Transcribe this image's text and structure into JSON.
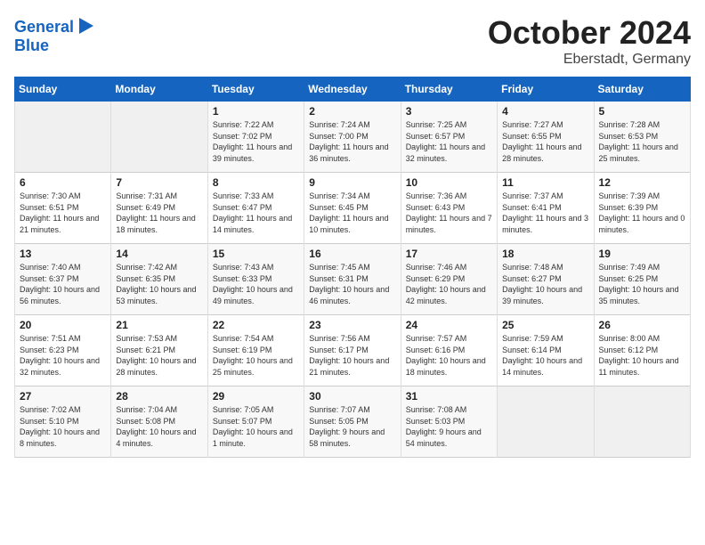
{
  "header": {
    "logo_line1": "General",
    "logo_line2": "Blue",
    "month": "October 2024",
    "location": "Eberstadt, Germany"
  },
  "days_of_week": [
    "Sunday",
    "Monday",
    "Tuesday",
    "Wednesday",
    "Thursday",
    "Friday",
    "Saturday"
  ],
  "weeks": [
    [
      {
        "day": "",
        "info": ""
      },
      {
        "day": "",
        "info": ""
      },
      {
        "day": "1",
        "info": "Sunrise: 7:22 AM\nSunset: 7:02 PM\nDaylight: 11 hours and 39 minutes."
      },
      {
        "day": "2",
        "info": "Sunrise: 7:24 AM\nSunset: 7:00 PM\nDaylight: 11 hours and 36 minutes."
      },
      {
        "day": "3",
        "info": "Sunrise: 7:25 AM\nSunset: 6:57 PM\nDaylight: 11 hours and 32 minutes."
      },
      {
        "day": "4",
        "info": "Sunrise: 7:27 AM\nSunset: 6:55 PM\nDaylight: 11 hours and 28 minutes."
      },
      {
        "day": "5",
        "info": "Sunrise: 7:28 AM\nSunset: 6:53 PM\nDaylight: 11 hours and 25 minutes."
      }
    ],
    [
      {
        "day": "6",
        "info": "Sunrise: 7:30 AM\nSunset: 6:51 PM\nDaylight: 11 hours and 21 minutes."
      },
      {
        "day": "7",
        "info": "Sunrise: 7:31 AM\nSunset: 6:49 PM\nDaylight: 11 hours and 18 minutes."
      },
      {
        "day": "8",
        "info": "Sunrise: 7:33 AM\nSunset: 6:47 PM\nDaylight: 11 hours and 14 minutes."
      },
      {
        "day": "9",
        "info": "Sunrise: 7:34 AM\nSunset: 6:45 PM\nDaylight: 11 hours and 10 minutes."
      },
      {
        "day": "10",
        "info": "Sunrise: 7:36 AM\nSunset: 6:43 PM\nDaylight: 11 hours and 7 minutes."
      },
      {
        "day": "11",
        "info": "Sunrise: 7:37 AM\nSunset: 6:41 PM\nDaylight: 11 hours and 3 minutes."
      },
      {
        "day": "12",
        "info": "Sunrise: 7:39 AM\nSunset: 6:39 PM\nDaylight: 11 hours and 0 minutes."
      }
    ],
    [
      {
        "day": "13",
        "info": "Sunrise: 7:40 AM\nSunset: 6:37 PM\nDaylight: 10 hours and 56 minutes."
      },
      {
        "day": "14",
        "info": "Sunrise: 7:42 AM\nSunset: 6:35 PM\nDaylight: 10 hours and 53 minutes."
      },
      {
        "day": "15",
        "info": "Sunrise: 7:43 AM\nSunset: 6:33 PM\nDaylight: 10 hours and 49 minutes."
      },
      {
        "day": "16",
        "info": "Sunrise: 7:45 AM\nSunset: 6:31 PM\nDaylight: 10 hours and 46 minutes."
      },
      {
        "day": "17",
        "info": "Sunrise: 7:46 AM\nSunset: 6:29 PM\nDaylight: 10 hours and 42 minutes."
      },
      {
        "day": "18",
        "info": "Sunrise: 7:48 AM\nSunset: 6:27 PM\nDaylight: 10 hours and 39 minutes."
      },
      {
        "day": "19",
        "info": "Sunrise: 7:49 AM\nSunset: 6:25 PM\nDaylight: 10 hours and 35 minutes."
      }
    ],
    [
      {
        "day": "20",
        "info": "Sunrise: 7:51 AM\nSunset: 6:23 PM\nDaylight: 10 hours and 32 minutes."
      },
      {
        "day": "21",
        "info": "Sunrise: 7:53 AM\nSunset: 6:21 PM\nDaylight: 10 hours and 28 minutes."
      },
      {
        "day": "22",
        "info": "Sunrise: 7:54 AM\nSunset: 6:19 PM\nDaylight: 10 hours and 25 minutes."
      },
      {
        "day": "23",
        "info": "Sunrise: 7:56 AM\nSunset: 6:17 PM\nDaylight: 10 hours and 21 minutes."
      },
      {
        "day": "24",
        "info": "Sunrise: 7:57 AM\nSunset: 6:16 PM\nDaylight: 10 hours and 18 minutes."
      },
      {
        "day": "25",
        "info": "Sunrise: 7:59 AM\nSunset: 6:14 PM\nDaylight: 10 hours and 14 minutes."
      },
      {
        "day": "26",
        "info": "Sunrise: 8:00 AM\nSunset: 6:12 PM\nDaylight: 10 hours and 11 minutes."
      }
    ],
    [
      {
        "day": "27",
        "info": "Sunrise: 7:02 AM\nSunset: 5:10 PM\nDaylight: 10 hours and 8 minutes."
      },
      {
        "day": "28",
        "info": "Sunrise: 7:04 AM\nSunset: 5:08 PM\nDaylight: 10 hours and 4 minutes."
      },
      {
        "day": "29",
        "info": "Sunrise: 7:05 AM\nSunset: 5:07 PM\nDaylight: 10 hours and 1 minute."
      },
      {
        "day": "30",
        "info": "Sunrise: 7:07 AM\nSunset: 5:05 PM\nDaylight: 9 hours and 58 minutes."
      },
      {
        "day": "31",
        "info": "Sunrise: 7:08 AM\nSunset: 5:03 PM\nDaylight: 9 hours and 54 minutes."
      },
      {
        "day": "",
        "info": ""
      },
      {
        "day": "",
        "info": ""
      }
    ]
  ]
}
